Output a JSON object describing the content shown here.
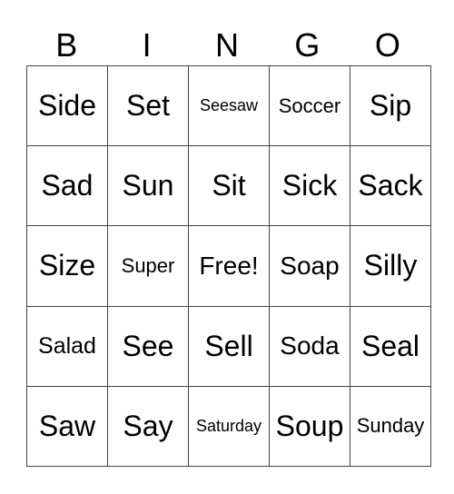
{
  "header": [
    "B",
    "I",
    "N",
    "G",
    "O"
  ],
  "rows": [
    [
      "Side",
      "Set",
      "Seesaw",
      "Soccer",
      "Sip"
    ],
    [
      "Sad",
      "Sun",
      "Sit",
      "Sick",
      "Sack"
    ],
    [
      "Size",
      "Super",
      "Free!",
      "Soap",
      "Silly"
    ],
    [
      "Salad",
      "See",
      "Sell",
      "Soda",
      "Seal"
    ],
    [
      "Saw",
      "Say",
      "Saturday",
      "Soup",
      "Sunday"
    ]
  ]
}
